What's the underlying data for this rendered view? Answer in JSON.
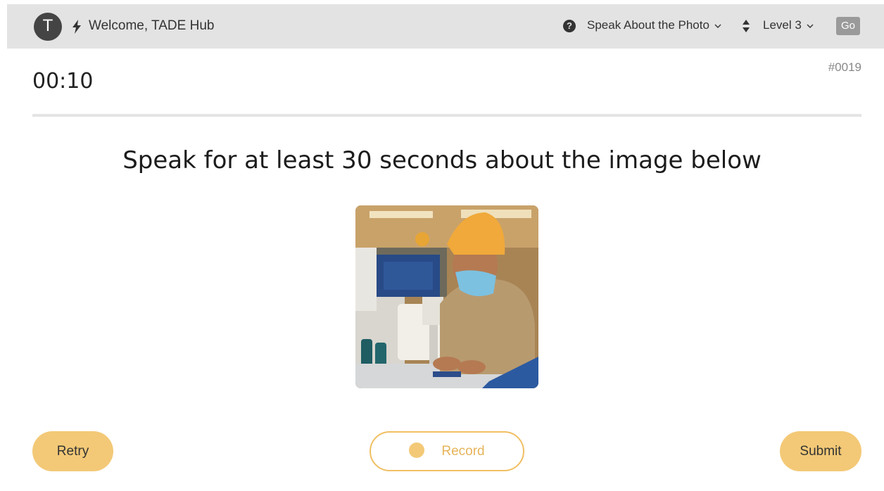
{
  "header": {
    "avatar_letter": "T",
    "welcome": "Welcome, TADE Hub",
    "mode": "Speak About the Photo",
    "level": "Level 3",
    "go_label": "Go",
    "icons": [
      "bolt-icon",
      "help-icon",
      "sort-icon",
      "chevron-down-icon"
    ]
  },
  "timer": "00:10",
  "question_id": "#0019",
  "prompt": "Speak for at least 30 seconds about the image below",
  "photo": {
    "subject": "factory-worker-at-sewing-machine"
  },
  "actions": {
    "retry": "Retry",
    "record": "Record",
    "submit": "Submit"
  },
  "colors": {
    "accent": "#f3c977",
    "accent_border": "#f0bf63",
    "topbar_bg": "#e3e3e3",
    "go_bg": "#9a9a9a"
  }
}
